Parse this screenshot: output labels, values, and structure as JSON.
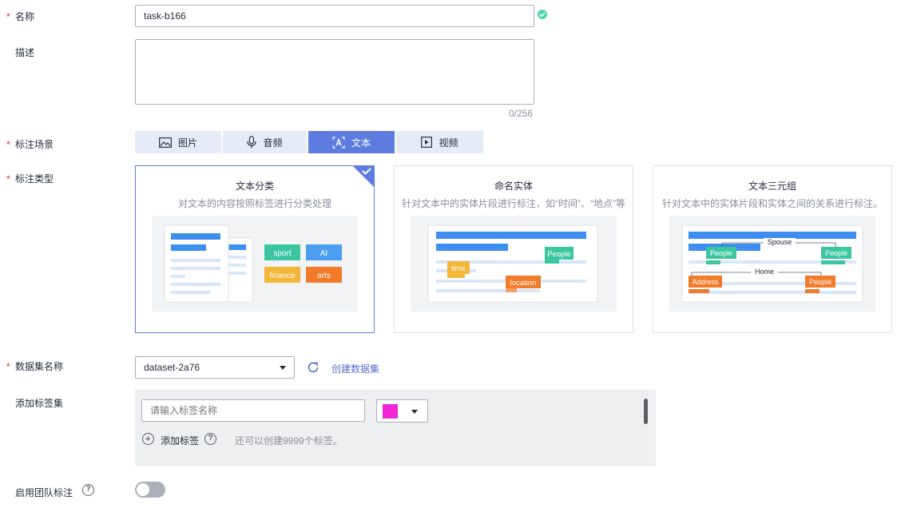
{
  "form": {
    "name_label": "名称",
    "name_value": "task-b166",
    "desc_label": "描述",
    "desc_value": "",
    "desc_counter": "0/256",
    "scene_label": "标注场景",
    "scenes": [
      {
        "label": "图片",
        "icon": "image-icon",
        "active": false
      },
      {
        "label": "音频",
        "icon": "microphone-icon",
        "active": false
      },
      {
        "label": "文本",
        "icon": "text-icon",
        "active": true
      },
      {
        "label": "视频",
        "icon": "video-icon",
        "active": false
      }
    ],
    "type_label": "标注类型",
    "types": [
      {
        "title": "文本分类",
        "desc": "对文本的内容按照标签进行分类处理",
        "selected": true,
        "tags": [
          "sport",
          "AI",
          "finance",
          "arts"
        ]
      },
      {
        "title": "命名实体",
        "desc": "针对文本中的实体片段进行标注，如“时间”、“地点”等",
        "selected": false,
        "tags": [
          "People",
          "time",
          "location"
        ]
      },
      {
        "title": "文本三元组",
        "desc": "针对文本中的实体片段和实体之间的关系进行标注。",
        "selected": false,
        "tags": [
          "Spouse",
          "People",
          "People",
          "Home",
          "Address",
          "People"
        ]
      }
    ],
    "dataset_label": "数据集名称",
    "dataset_value": "dataset-2a76",
    "create_dataset_link": "创建数据集",
    "tagset_label": "添加标签集",
    "tag_name_placeholder": "请输入标签名称",
    "tag_color": "#f224d6",
    "add_tag_label": "添加标签",
    "tag_quota_hint": "还可以创建9999个标签。",
    "team_label": "启用团队标注",
    "team_enabled": false
  },
  "colors": {
    "accent": "#5e7ce0",
    "required": "#f5222d",
    "success": "#50d4ab",
    "link": "#526ecc"
  }
}
